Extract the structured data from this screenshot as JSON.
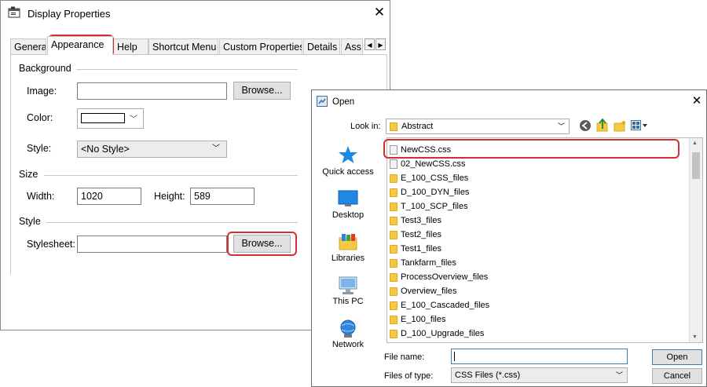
{
  "display_properties": {
    "title": "Display Properties",
    "close_glyph": "✕",
    "tabs": [
      {
        "label": "General"
      },
      {
        "label": "Appearance",
        "active": true
      },
      {
        "label": "Help"
      },
      {
        "label": "Shortcut Menu"
      },
      {
        "label": "Custom Properties"
      },
      {
        "label": "Details"
      },
      {
        "label": "Ass"
      }
    ],
    "tab_scroll": {
      "left": "◀",
      "right": "▶"
    },
    "background_group": "Background",
    "image_label": "Image:",
    "image_value": "",
    "image_browse": "Browse...",
    "color_label": "Color:",
    "color_swatch": "#ffffff",
    "style_label": "Style:",
    "style_value": "<No Style>",
    "size_group": "Size",
    "width_label": "Width:",
    "width_value": "1020",
    "height_label": "Height:",
    "height_value": "589",
    "style_group": "Style",
    "stylesheet_label": "Stylesheet:",
    "stylesheet_value": "",
    "stylesheet_browse": "Browse..."
  },
  "open_dialog": {
    "title": "Open",
    "close_glyph": "✕",
    "look_in_label": "Look in:",
    "look_in_value": "Abstract",
    "places": [
      {
        "label": "Quick access",
        "icon": "star-icon"
      },
      {
        "label": "Desktop",
        "icon": "desktop-icon"
      },
      {
        "label": "Libraries",
        "icon": "libraries-icon"
      },
      {
        "label": "This PC",
        "icon": "computer-icon"
      },
      {
        "label": "Network",
        "icon": "network-icon"
      }
    ],
    "files": [
      {
        "name": "NewCSS.css",
        "type": "file"
      },
      {
        "name": "02_NewCSS.css",
        "type": "file"
      },
      {
        "name": "E_100_CSS_files",
        "type": "folder"
      },
      {
        "name": "D_100_DYN_files",
        "type": "folder"
      },
      {
        "name": "T_100_SCP_files",
        "type": "folder"
      },
      {
        "name": "Test3_files",
        "type": "folder"
      },
      {
        "name": "Test2_files",
        "type": "folder"
      },
      {
        "name": "Test1_files",
        "type": "folder"
      },
      {
        "name": "Tankfarm_files",
        "type": "folder"
      },
      {
        "name": "ProcessOverview_files",
        "type": "folder"
      },
      {
        "name": "Overview_files",
        "type": "folder"
      },
      {
        "name": "E_100_Cascaded_files",
        "type": "folder"
      },
      {
        "name": "E_100_files",
        "type": "folder"
      },
      {
        "name": "D_100_Upgrade_files",
        "type": "folder"
      }
    ],
    "file_name_label": "File name:",
    "file_name_value": "",
    "files_of_type_label": "Files of type:",
    "files_of_type_value": "CSS Files (*.css)",
    "open_button": "Open",
    "cancel_button": "Cancel"
  },
  "highlight_color": "#d32f2f"
}
